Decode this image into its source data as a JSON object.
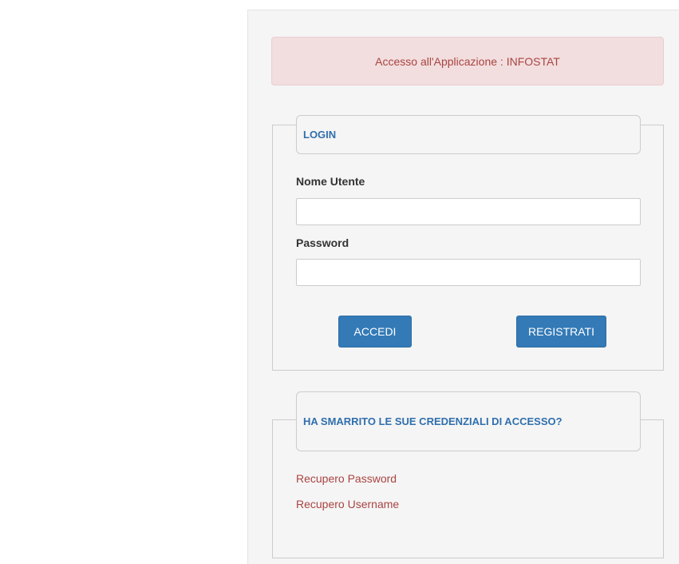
{
  "alert": {
    "text": "Accesso all'Applicazione : INFOSTAT"
  },
  "login": {
    "legend": "LOGIN",
    "username_label": "Nome Utente",
    "username_value": "",
    "password_label": "Password",
    "password_value": "",
    "login_button": "ACCEDI",
    "register_button": "REGISTRATI"
  },
  "recovery": {
    "legend": "HA SMARRITO LE SUE CREDENZIALI DI ACCESSO?",
    "password_link": "Recupero Password",
    "username_link": "Recupero Username"
  },
  "colors": {
    "panel_background": "#f5f5f5",
    "alert_background": "#f2dede",
    "alert_text": "#a94442",
    "legend_text": "#2f6fad",
    "button_primary": "#337ab7",
    "link": "#a94442"
  }
}
